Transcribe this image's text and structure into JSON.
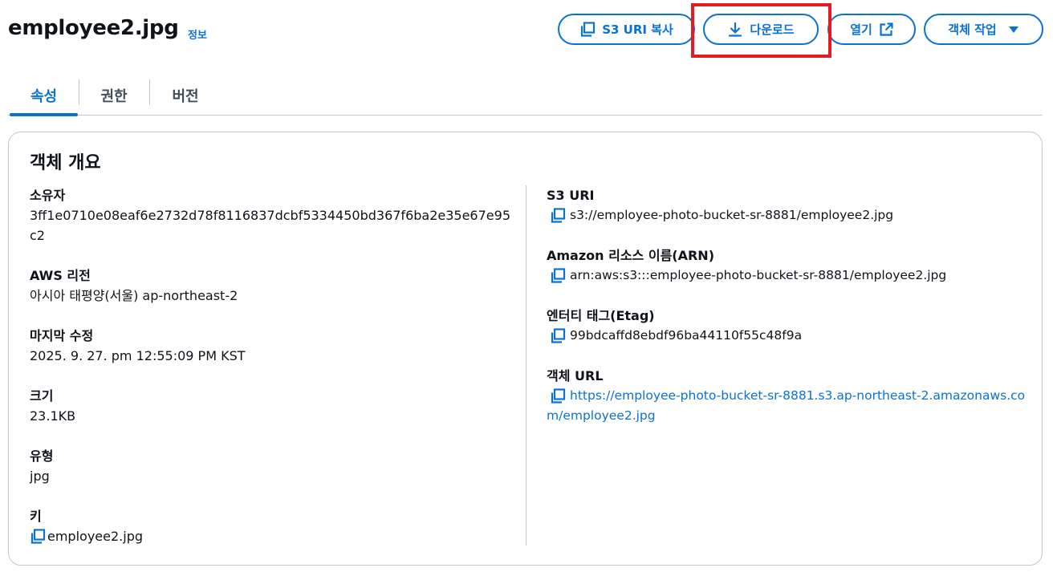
{
  "header": {
    "title": "employee2.jpg",
    "info_link": "정보",
    "buttons": {
      "copy_uri": "S3 URI 복사",
      "download": "다운로드",
      "open": "열기",
      "actions": "객체 작업"
    }
  },
  "tabs": [
    {
      "label": "속성",
      "active": true
    },
    {
      "label": "권한",
      "active": false
    },
    {
      "label": "버전",
      "active": false
    }
  ],
  "overview": {
    "title": "객체 개요",
    "left": {
      "owner": {
        "label": "소유자",
        "value": "3ff1e0710e08eaf6e2732d78f8116837dcbf5334450bd367f6ba2e35e67e95c2"
      },
      "region": {
        "label": "AWS 리전",
        "value": "아시아 태평양(서울) ap-northeast-2"
      },
      "last_modified": {
        "label": "마지막 수정",
        "value": "2025. 9. 27. pm 12:55:09 PM KST"
      },
      "size": {
        "label": "크기",
        "value": "23.1KB"
      },
      "type": {
        "label": "유형",
        "value": "jpg"
      },
      "key": {
        "label": "키",
        "value": "employee2.jpg"
      }
    },
    "right": {
      "s3_uri": {
        "label": "S3 URI",
        "value": "s3://employee-photo-bucket-sr-8881/employee2.jpg"
      },
      "arn": {
        "label": "Amazon 리소스 이름(ARN)",
        "value": "arn:aws:s3:::employee-photo-bucket-sr-8881/employee2.jpg"
      },
      "etag": {
        "label": "엔터티 태그(Etag)",
        "value": "99bdcaffd8ebdf96ba44110f55c48f9a"
      },
      "url": {
        "label": "객체 URL",
        "value": "https://employee-photo-bucket-sr-8881.s3.ap-northeast-2.amazonaws.com/employee2.jpg"
      }
    }
  },
  "colors": {
    "accent": "#0972d3",
    "highlight": "#e31b23",
    "text": "#0f141a",
    "border": "#c6c6cd"
  },
  "icons": [
    "copy-icon",
    "download-icon",
    "external-link-icon",
    "caret-down-icon"
  ]
}
